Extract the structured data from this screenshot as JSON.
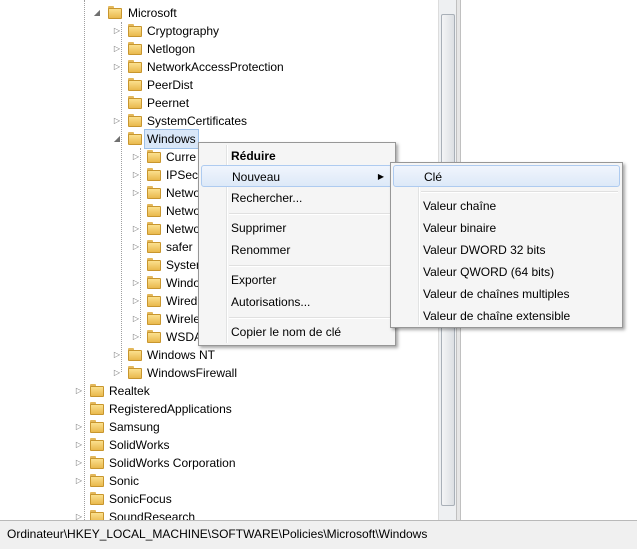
{
  "tree": {
    "microsoft": "Microsoft",
    "ms_children": [
      "Cryptography",
      "Netlogon",
      "NetworkAccessProtection",
      "PeerDist",
      "Peernet",
      "SystemCertificates"
    ],
    "windows": "Windows",
    "win_children": [
      "Curre",
      "IPSec",
      "Netwo",
      "Netwo",
      "Netwo",
      "safer",
      "Syster",
      "Windo",
      "Wired",
      "Wirele",
      "WSDA"
    ],
    "windows_nt": "Windows NT",
    "windows_firewall": "WindowsFirewall",
    "top_children": [
      "Realtek",
      "RegisteredApplications",
      "Samsung",
      "SolidWorks",
      "SolidWorks Corporation",
      "Sonic",
      "SonicFocus",
      "SoundResearch"
    ]
  },
  "context_menu": {
    "items": [
      "Réduire",
      "Nouveau",
      "Rechercher...",
      "Supprimer",
      "Renommer",
      "Exporter",
      "Autorisations...",
      "Copier le nom de clé"
    ]
  },
  "submenu": {
    "items": [
      "Clé",
      "Valeur chaîne",
      "Valeur binaire",
      "Valeur DWORD 32 bits",
      "Valeur QWORD (64 bits)",
      "Valeur de chaînes multiples",
      "Valeur de chaîne extensible"
    ]
  },
  "status": {
    "path": "Ordinateur\\HKEY_LOCAL_MACHINE\\SOFTWARE\\Policies\\Microsoft\\Windows"
  }
}
